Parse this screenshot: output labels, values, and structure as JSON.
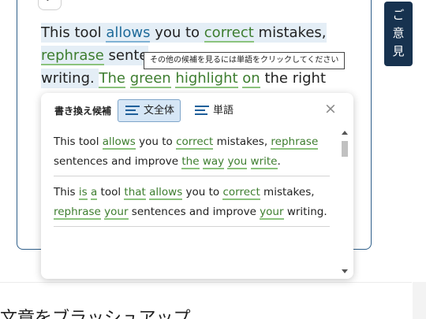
{
  "editor": {
    "undo_icon": "undo-icon",
    "undo_glyph": "↶",
    "line1": [
      "This tool ",
      "allows",
      " you to ",
      "correct",
      " mistakes,"
    ],
    "line2": [
      "rephrase",
      " sente"
    ],
    "line3": [
      "writing. ",
      "The",
      " ",
      "green",
      " ",
      "highlight",
      " ",
      "on",
      " the right"
    ]
  },
  "tooltip": {
    "text": "その他の候補を見るには単語をクリックしてください"
  },
  "feedback": {
    "label_chars": [
      "ご",
      "意",
      "見"
    ]
  },
  "popup": {
    "title": "書き換え候補",
    "tabs": [
      {
        "label": "文全体",
        "icon": "align-left-icon",
        "selected": true
      },
      {
        "label": "単語",
        "icon": "align-left-icon",
        "selected": false
      }
    ],
    "close_icon": "close-icon",
    "close_glyph": "×",
    "suggestions": [
      [
        "This tool ",
        "allows",
        " you to ",
        "correct",
        " mistakes, ",
        "rephrase",
        " sentences and improve ",
        "the",
        " ",
        "way",
        " ",
        "you",
        " ",
        "write",
        "."
      ],
      [
        "This ",
        "is",
        " ",
        "a",
        " tool ",
        "that",
        " ",
        "allows",
        " you to ",
        "correct",
        " mistakes, ",
        "rephrase",
        " ",
        "your",
        " sentences and improve ",
        "your",
        " writing."
      ]
    ],
    "suggestion_highlights": [
      [
        false,
        true,
        false,
        true,
        false,
        true,
        false,
        true,
        false,
        true,
        false,
        true,
        false,
        true,
        false
      ],
      [
        false,
        true,
        false,
        true,
        false,
        true,
        false,
        true,
        false,
        true,
        false,
        true,
        false,
        true,
        false,
        true,
        false
      ]
    ]
  },
  "page": {
    "lower_heading": "文章をブラッシュアップ"
  },
  "colors": {
    "accent": "#17324f",
    "highlight_green": "#3d7d2f",
    "selection_bg": "#e4eef6"
  }
}
